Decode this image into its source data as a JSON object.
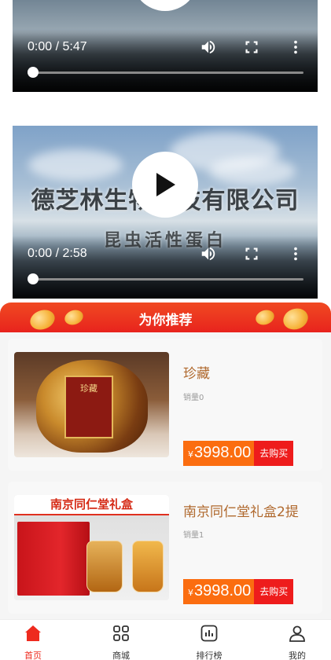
{
  "videos": [
    {
      "time": "0:00 / 5:47",
      "progress": 0.0
    },
    {
      "time": "0:00 / 2:58",
      "progress": 0.0,
      "overlay_title": "德芝林生物科技有限公司",
      "overlay_subtitle": "昆虫活性蛋白"
    }
  ],
  "recommend": {
    "title": "为你推荐"
  },
  "products": [
    {
      "name": "珍藏",
      "sales": "销量0",
      "currency": "¥",
      "price": "3998.00",
      "buy_label": "去购买",
      "image_label": "珍藏"
    },
    {
      "name": "南京同仁堂礼盒2提",
      "sales": "销量1",
      "currency": "¥",
      "price": "3998.00",
      "buy_label": "去购买",
      "image_label": "南京同仁堂礼盒"
    }
  ],
  "tabbar": {
    "active_color": "#ee2a1e",
    "items": [
      {
        "label": "首页",
        "icon": "home-icon",
        "active": true
      },
      {
        "label": "商城",
        "icon": "grid-icon",
        "active": false
      },
      {
        "label": "排行榜",
        "icon": "chart-icon",
        "active": false
      },
      {
        "label": "我的",
        "icon": "user-icon",
        "active": false
      }
    ]
  }
}
